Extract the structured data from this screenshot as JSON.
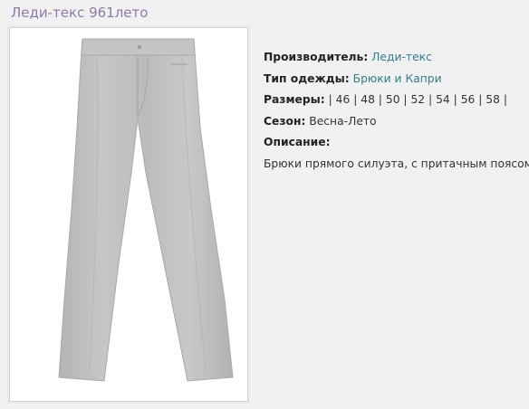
{
  "product": {
    "title": "Леди-текс 961лето"
  },
  "details": {
    "manufacturer_label": "Производитель:",
    "manufacturer_value": "Леди-текс",
    "clothing_type_label": "Тип одежды:",
    "clothing_type_value": "Брюки и Капри",
    "sizes_label": "Размеры:",
    "sizes_value": " | 46 | 48 | 50 | 52 | 54 | 56 | 58 |",
    "season_label": "Сезон:",
    "season_value": "Весна-Лето",
    "description_label": "Описание:",
    "description_value": "Брюки прямого силуэта, с притачным поясом."
  },
  "photo": {
    "icon": "trousers-image",
    "color": "#bfbfc1"
  },
  "colors": {
    "title": "#8a7aa6",
    "link": "#2f7f87",
    "background": "#f1f1f1"
  }
}
